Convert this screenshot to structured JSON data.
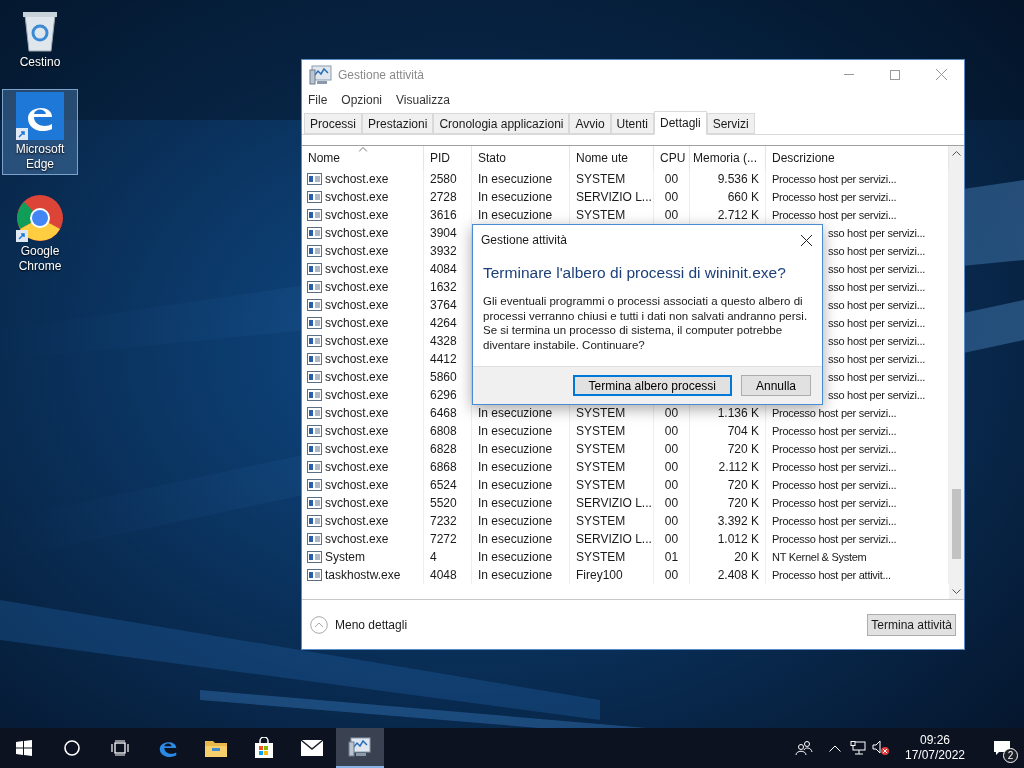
{
  "desktop_icons": [
    {
      "label": "Cestino",
      "kind": "bin",
      "selected": false
    },
    {
      "label": "Microsoft Edge",
      "kind": "edge",
      "selected": true
    },
    {
      "label": "Google Chrome",
      "kind": "chrome",
      "selected": false
    }
  ],
  "task_manager": {
    "title": "Gestione attività",
    "menu": [
      "File",
      "Opzioni",
      "Visualizza"
    ],
    "tabs": [
      {
        "label": "Processi",
        "selected": false
      },
      {
        "label": "Prestazioni",
        "selected": false
      },
      {
        "label": "Cronologia applicazioni",
        "selected": false
      },
      {
        "label": "Avvio",
        "selected": false
      },
      {
        "label": "Utenti",
        "selected": false
      },
      {
        "label": "Dettagli",
        "selected": true
      },
      {
        "label": "Servizi",
        "selected": false
      }
    ],
    "columns": [
      {
        "label": "Nome",
        "sorted": true
      },
      {
        "label": "PID",
        "sorted": false
      },
      {
        "label": "Stato",
        "sorted": false
      },
      {
        "label": "Nome ute",
        "sorted": false
      },
      {
        "label": "CPU",
        "sorted": false
      },
      {
        "label": "Memoria (...",
        "sorted": false
      },
      {
        "label": "Descrizione",
        "sorted": false
      }
    ],
    "rows": [
      {
        "name": "svchost.exe",
        "pid": "2580",
        "status": "In esecuzione",
        "user": "SYSTEM",
        "cpu": "00",
        "memory": "9.536 K",
        "description": "Processo host per servizi..."
      },
      {
        "name": "svchost.exe",
        "pid": "2728",
        "status": "In esecuzione",
        "user": "SERVIZIO L...",
        "cpu": "00",
        "memory": "660 K",
        "description": "Processo host per servizi..."
      },
      {
        "name": "svchost.exe",
        "pid": "3616",
        "status": "In esecuzione",
        "user": "SYSTEM",
        "cpu": "00",
        "memory": "2.712 K",
        "description": "Processo host per servizi..."
      },
      {
        "name": "svchost.exe",
        "pid": "3904",
        "description": "sso host per servizi..."
      },
      {
        "name": "svchost.exe",
        "pid": "3932",
        "description": "sso host per servizi..."
      },
      {
        "name": "svchost.exe",
        "pid": "4084",
        "description": "sso host per servizi..."
      },
      {
        "name": "svchost.exe",
        "pid": "1632",
        "description": "sso host per servizi..."
      },
      {
        "name": "svchost.exe",
        "pid": "3764",
        "description": "sso host per servizi..."
      },
      {
        "name": "svchost.exe",
        "pid": "4264",
        "description": "sso host per servizi..."
      },
      {
        "name": "svchost.exe",
        "pid": "4328",
        "description": "sso host per servizi..."
      },
      {
        "name": "svchost.exe",
        "pid": "4412",
        "description": "sso host per servizi..."
      },
      {
        "name": "svchost.exe",
        "pid": "5860",
        "description": "sso host per servizi..."
      },
      {
        "name": "svchost.exe",
        "pid": "6296",
        "description": "sso host per servizi..."
      },
      {
        "name": "svchost.exe",
        "pid": "6468",
        "status": "In esecuzione",
        "user": "SYSTEM",
        "cpu": "00",
        "memory": "1.136 K",
        "description": "Processo host per servizi..."
      },
      {
        "name": "svchost.exe",
        "pid": "6808",
        "status": "In esecuzione",
        "user": "SYSTEM",
        "cpu": "00",
        "memory": "704 K",
        "description": "Processo host per servizi..."
      },
      {
        "name": "svchost.exe",
        "pid": "6828",
        "status": "In esecuzione",
        "user": "SYSTEM",
        "cpu": "00",
        "memory": "720 K",
        "description": "Processo host per servizi..."
      },
      {
        "name": "svchost.exe",
        "pid": "6868",
        "status": "In esecuzione",
        "user": "SYSTEM",
        "cpu": "00",
        "memory": "2.112 K",
        "description": "Processo host per servizi..."
      },
      {
        "name": "svchost.exe",
        "pid": "6524",
        "status": "In esecuzione",
        "user": "SYSTEM",
        "cpu": "00",
        "memory": "720 K",
        "description": "Processo host per servizi..."
      },
      {
        "name": "svchost.exe",
        "pid": "5520",
        "status": "In esecuzione",
        "user": "SERVIZIO L...",
        "cpu": "00",
        "memory": "720 K",
        "description": "Processo host per servizi..."
      },
      {
        "name": "svchost.exe",
        "pid": "7232",
        "status": "In esecuzione",
        "user": "SYSTEM",
        "cpu": "00",
        "memory": "3.392 K",
        "description": "Processo host per servizi..."
      },
      {
        "name": "svchost.exe",
        "pid": "7272",
        "status": "In esecuzione",
        "user": "SERVIZIO L...",
        "cpu": "00",
        "memory": "1.012 K",
        "description": "Processo host per servizi..."
      },
      {
        "name": "System",
        "pid": "4",
        "status": "In esecuzione",
        "user": "SYSTEM",
        "cpu": "01",
        "memory": "20 K",
        "description": "NT Kernel & System"
      },
      {
        "name": "taskhostw.exe",
        "pid": "4048",
        "status": "In esecuzione",
        "user": "Firey100",
        "cpu": "00",
        "memory": "2.408 K",
        "description": "Processo host per attivit..."
      }
    ],
    "less_details": "Meno dettagli",
    "end_task": "Termina attività"
  },
  "dialog": {
    "title": "Gestione attività",
    "heading": "Terminare l'albero di processi di wininit.exe?",
    "message": "Gli eventuali programmi o processi associati a questo albero di processi verranno chiusi e tutti i dati non salvati andranno persi. Se si termina un processo di sistema, il computer potrebbe diventare instabile. Continuare?",
    "buttons": [
      {
        "label": "Termina albero processi",
        "default": true
      },
      {
        "label": "Annulla",
        "default": false
      }
    ]
  },
  "taskbar": {
    "apps": [
      {
        "kind": "edge",
        "active": false
      },
      {
        "kind": "folder",
        "active": false
      },
      {
        "kind": "store",
        "active": false
      },
      {
        "kind": "mail",
        "active": false
      },
      {
        "kind": "taskmgr",
        "active": true
      }
    ],
    "time": "09:26",
    "date": "17/07/2022",
    "notifications": "2"
  }
}
